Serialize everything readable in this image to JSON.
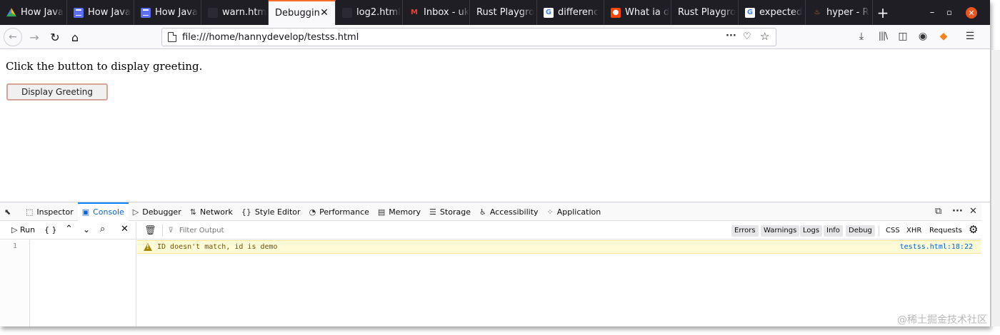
{
  "tabs": [
    {
      "title": "How Java",
      "icon": "drive-icon",
      "icon_class": "ic-drive",
      "icon_glyph": ""
    },
    {
      "title": "How Java",
      "icon": "docs-icon",
      "icon_class": "ic-doc",
      "icon_glyph": ""
    },
    {
      "title": "How Java",
      "icon": "docs-icon",
      "icon_class": "ic-doc",
      "icon_glyph": ""
    },
    {
      "title": "warn.htm",
      "icon": "github-icon",
      "icon_class": "ic-gh",
      "icon_glyph": ""
    },
    {
      "title": "Debuggin",
      "icon": "",
      "icon_class": "",
      "icon_glyph": "",
      "active": true
    },
    {
      "title": "log2.html",
      "icon": "github-icon",
      "icon_class": "ic-gh",
      "icon_glyph": ""
    },
    {
      "title": "Inbox - uk",
      "icon": "gmail-icon",
      "icon_class": "ic-gmail",
      "icon_glyph": "M"
    },
    {
      "title": "Rust Playgro",
      "icon": "",
      "icon_class": "",
      "icon_glyph": ""
    },
    {
      "title": "differenc",
      "icon": "google-icon",
      "icon_class": "ic-google",
      "icon_glyph": "G"
    },
    {
      "title": "What ia d",
      "icon": "reddit-icon",
      "icon_class": "ic-reddit",
      "icon_glyph": "●"
    },
    {
      "title": "Rust Playgro",
      "icon": "",
      "icon_class": "",
      "icon_glyph": ""
    },
    {
      "title": "expected",
      "icon": "google-icon",
      "icon_class": "ic-google",
      "icon_glyph": "G"
    },
    {
      "title": "hyper - R",
      "icon": "hyper-icon",
      "icon_class": "ic-hyper",
      "icon_glyph": "♨"
    }
  ],
  "tab_widths": [
    94,
    94,
    94,
    94,
    94,
    94,
    94,
    94,
    94,
    94,
    94,
    94,
    94
  ],
  "address": {
    "url": "file:///home/hannydevelop/testss.html"
  },
  "page": {
    "greeting_text": "Click the button to display greeting.",
    "button_label": "Display Greeting"
  },
  "devtools": {
    "tabs": [
      {
        "label": "Inspector",
        "icon": "inspector-icon",
        "glyph": "⬚"
      },
      {
        "label": "Console",
        "icon": "console-icon",
        "glyph": "▣",
        "active": true
      },
      {
        "label": "Debugger",
        "icon": "debugger-icon",
        "glyph": "▷"
      },
      {
        "label": "Network",
        "icon": "network-icon",
        "glyph": "⇅"
      },
      {
        "label": "Style Editor",
        "icon": "style-editor-icon",
        "glyph": "{}"
      },
      {
        "label": "Performance",
        "icon": "performance-icon",
        "glyph": "◔"
      },
      {
        "label": "Memory",
        "icon": "memory-icon",
        "glyph": "▤"
      },
      {
        "label": "Storage",
        "icon": "storage-icon",
        "glyph": "☰"
      },
      {
        "label": "Accessibility",
        "icon": "accessibility-icon",
        "glyph": "♿"
      },
      {
        "label": "Application",
        "icon": "application-icon",
        "glyph": "⁘"
      }
    ],
    "run_label": "Run",
    "pretty_label": "{ }",
    "filter_placeholder": "Filter Output",
    "filters": [
      "Errors",
      "Warnings",
      "Logs",
      "Info",
      "Debug"
    ],
    "extra_filters": [
      "CSS",
      "XHR",
      "Requests"
    ],
    "line_number": "1",
    "message": {
      "text": "ID doesn't match, id is demo",
      "source": "testss.html:18:22",
      "level": "warning"
    }
  },
  "watermark": "@稀土掘金技术社区",
  "colors": {
    "tab_bg": "#1f1e25",
    "active_accent": "#f56d2b",
    "console_accent": "#0a84ff",
    "warning_bg": "#fffbd6"
  }
}
